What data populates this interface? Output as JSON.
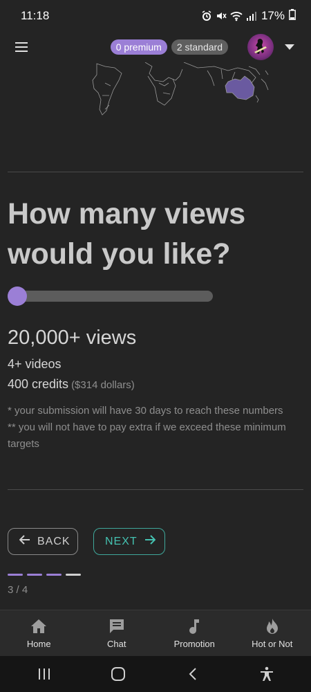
{
  "status_bar": {
    "time": "11:18",
    "battery": "17%",
    "icons": [
      "alarm-icon",
      "mute-icon",
      "wifi-icon",
      "signal-icon",
      "battery-icon"
    ]
  },
  "app_bar": {
    "premium_badge": "0 premium",
    "standard_badge": "2 standard",
    "icons": [
      "menu-icon",
      "avatar",
      "dropdown-icon"
    ]
  },
  "question": {
    "line1": "How many views",
    "line2": "would you like?"
  },
  "slider": {
    "value_fraction": 0.0
  },
  "result": {
    "views": "20,000+ views",
    "videos": "4+ videos",
    "credits": "400 credits",
    "dollars": "($314 dollars)"
  },
  "notes": {
    "line1": "* your submission will have 30 days to reach these numbers",
    "line2": "** you will not have to pay extra if we exceed these minimum targets"
  },
  "buttons": {
    "back": "BACK",
    "next": "NEXT"
  },
  "progress": {
    "current": 3,
    "total": 4,
    "label": "3 / 4"
  },
  "bottom_nav": {
    "items": [
      {
        "label": "Home",
        "icon": "home-icon"
      },
      {
        "label": "Chat",
        "icon": "chat-icon"
      },
      {
        "label": "Promotion",
        "icon": "music-note-icon"
      },
      {
        "label": "Hot or Not",
        "icon": "flame-icon"
      }
    ]
  },
  "system_nav": {
    "icons": [
      "recent-apps-icon",
      "home-button-icon",
      "back-icon",
      "accessibility-icon"
    ]
  },
  "colors": {
    "background": "#242424",
    "accent": "#9b7fd6",
    "next_accent": "#45c2b1",
    "track": "#5c5c5c",
    "step_inactive": "#d0d0d0"
  }
}
